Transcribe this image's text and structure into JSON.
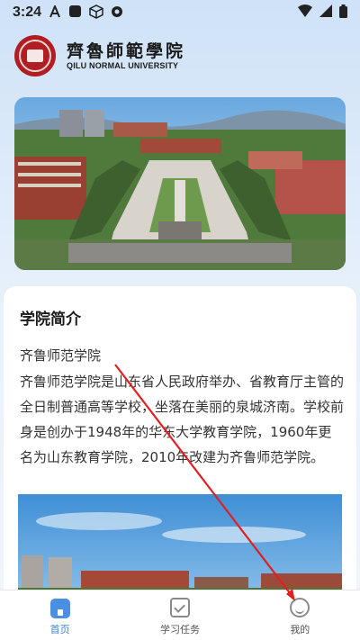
{
  "status_bar": {
    "time": "3:24",
    "left_icons": [
      "accessibility-icon",
      "square-app-icon",
      "box-icon",
      "settings-icon"
    ],
    "right_icons": [
      "wifi-icon",
      "signal-icon",
      "battery-icon"
    ]
  },
  "header": {
    "logo_cn": "齊魯師範學院",
    "logo_en": "QILU NORMAL UNIVERSITY"
  },
  "intro": {
    "title": "学院简介",
    "subtitle": "齐鲁师范学院",
    "body": "齐鲁师范学院是山东省人民政府举办、省教育厅主管的全日制普通高等学校，坐落在美丽的泉城济南。学校前身是创办于1948年的华东大学教育学院，1960年更名为山东教育学院，2010年改建为齐鲁师范学院。"
  },
  "tabbar": {
    "items": [
      {
        "label": "首页",
        "icon": "home-icon",
        "active": true
      },
      {
        "label": "学习任务",
        "icon": "task-check-icon",
        "active": false
      },
      {
        "label": "我的",
        "icon": "profile-icon",
        "active": false
      }
    ]
  },
  "colors": {
    "accent": "#3a86d8",
    "seal": "#b01e23",
    "annotation_arrow": "#e02020"
  }
}
